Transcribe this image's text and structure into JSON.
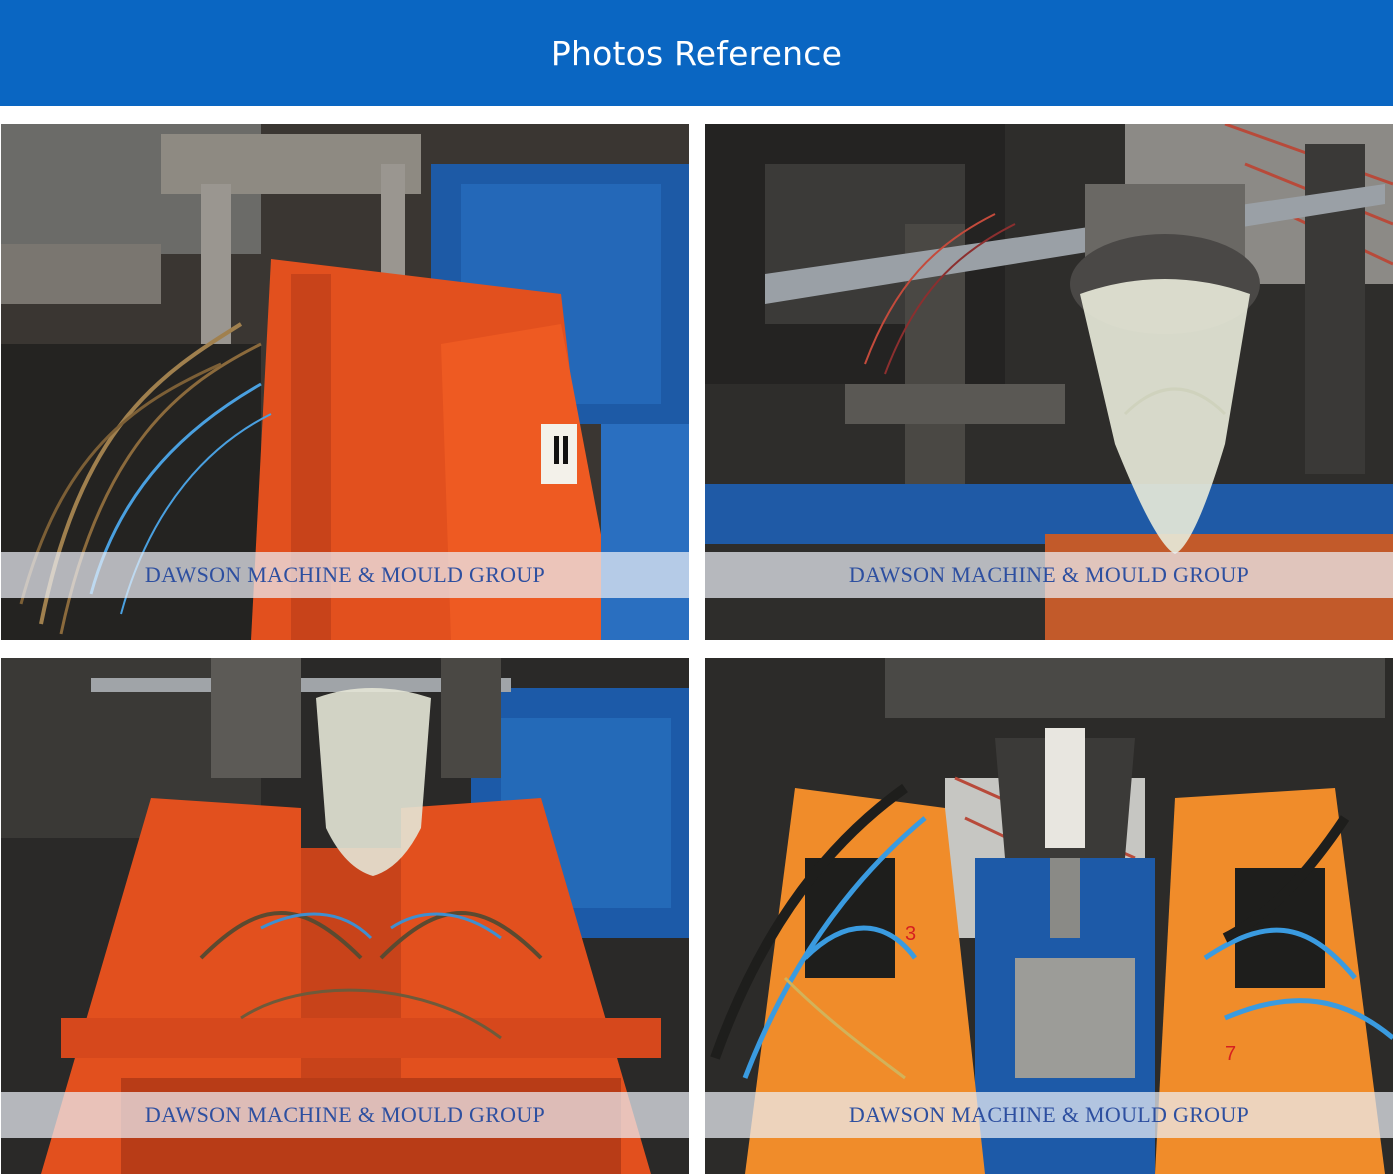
{
  "header": {
    "title": "Photos Reference",
    "background_color": "#0a66c2"
  },
  "photos": [
    {
      "watermark": "DAWSON MACHINE & MOULD GROUP",
      "subject": "orange machine frame with label plate",
      "label_plate_text": "II"
    },
    {
      "watermark": "DAWSON MACHINE & MOULD GROUP",
      "subject": "die head extruding translucent parison"
    },
    {
      "watermark": "DAWSON MACHINE & MOULD GROUP",
      "subject": "parison above open mould with hoses"
    },
    {
      "watermark": "DAWSON MACHINE & MOULD GROUP",
      "subject": "mould halves with blue air hoses",
      "mould_numbers": [
        "3",
        "7"
      ]
    }
  ],
  "colors": {
    "watermark_text": "#2d4fa0",
    "machine_orange": "#e2501e",
    "machine_blue": "#1c5aa8"
  }
}
